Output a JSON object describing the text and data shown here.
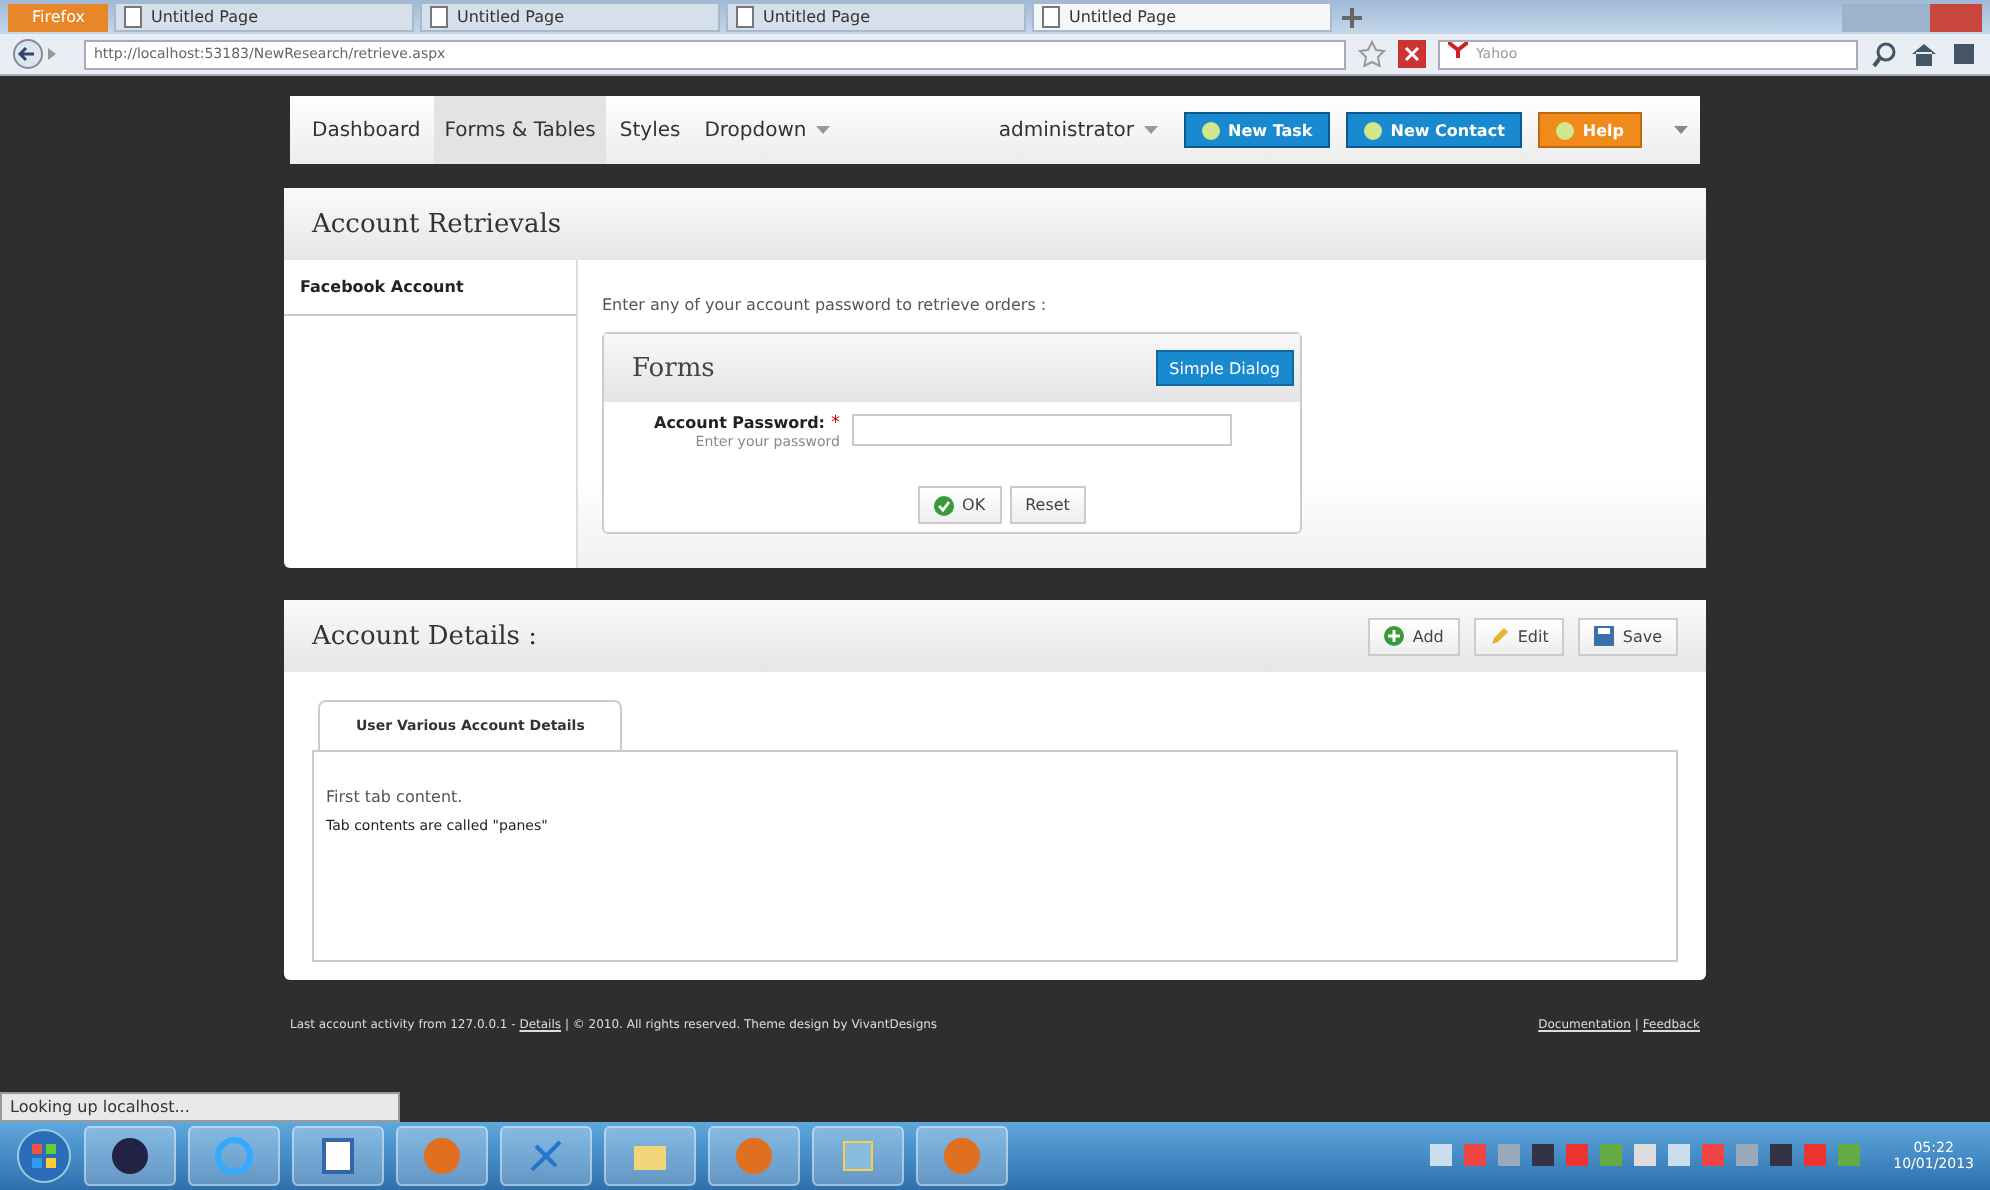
{
  "browser": {
    "menu_button": "Firefox",
    "tabs": [
      {
        "label": "Untitled Page",
        "selected": false
      },
      {
        "label": "Untitled Page",
        "selected": false
      },
      {
        "label": "Untitled Page",
        "selected": false
      },
      {
        "label": "Untitled Page",
        "selected": true
      }
    ],
    "url": "http://localhost:53183/NewResearch/retrieve.aspx",
    "search_placeholder": "Yahoo"
  },
  "nav": {
    "items": [
      {
        "label": "Dashboard",
        "selected": false,
        "dropdown": false
      },
      {
        "label": "Forms & Tables",
        "selected": true,
        "dropdown": false
      },
      {
        "label": "Styles",
        "selected": false,
        "dropdown": false
      },
      {
        "label": "Dropdown",
        "selected": false,
        "dropdown": true
      }
    ],
    "user": "administrator",
    "buttons": [
      {
        "label": "New Task",
        "kind": "blue"
      },
      {
        "label": "New Contact",
        "kind": "blue"
      },
      {
        "label": "Help",
        "kind": "orange"
      }
    ]
  },
  "retrievals": {
    "title": "Account Retrievals",
    "side_tabs": [
      {
        "label": "Facebook Account",
        "selected": true
      }
    ],
    "instruction": "Enter any of your account password to retrieve orders :",
    "form": {
      "title": "Forms",
      "dialog_button": "Simple Dialog",
      "field_label": "Account Password:",
      "required": "*",
      "hint": "Enter your password",
      "buttons": [
        {
          "label": "OK",
          "kind": "ok"
        },
        {
          "label": "Reset",
          "kind": "plain"
        }
      ]
    }
  },
  "details": {
    "title": "Account Details :",
    "actions": [
      {
        "label": "Add",
        "kind": "add"
      },
      {
        "label": "Edit",
        "kind": "edit"
      },
      {
        "label": "Save",
        "kind": "save"
      }
    ],
    "tabs": [
      {
        "label": "User Various Account Details",
        "selected": true
      }
    ],
    "content": [
      "First tab content.",
      "Tab contents are called \"panes\""
    ]
  },
  "footer": {
    "text_before": "Last account activity from 127.0.0.1 - ",
    "link": "Details",
    "text_after": " | © 2010. All rights reserved. Theme design by VivantDesigns",
    "right_links": [
      "Documentation",
      "Feedback"
    ],
    "separator": "|"
  },
  "status": "Looking up localhost...",
  "taskbar": {
    "time": "05:22",
    "date": "10/01/2013"
  }
}
